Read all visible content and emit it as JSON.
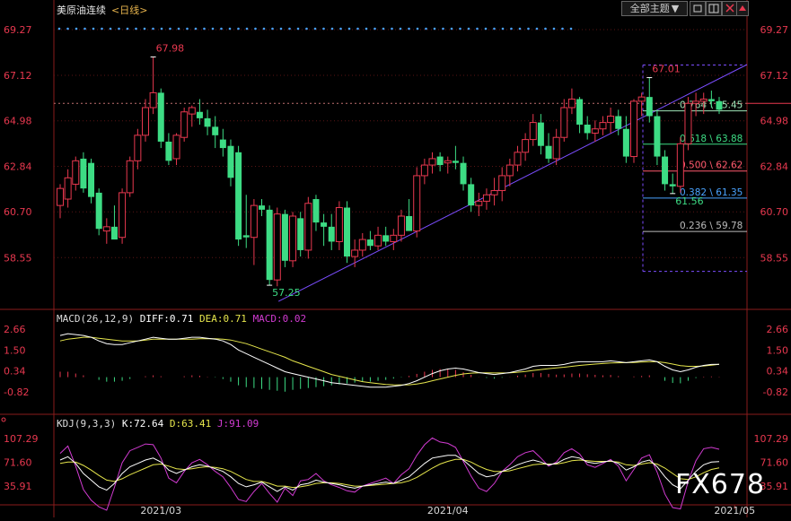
{
  "header": {
    "symbol": "美原油连续",
    "period": "<日线>",
    "theme_button": "全部主题",
    "theme_arrow": "▼"
  },
  "watermark": "FX678",
  "colors": {
    "up": "#e8384f",
    "down": "#3ddc84",
    "macd_diff": "#ffffff",
    "macd_dea": "#e6e64c",
    "macd_bar": "#d23bd2",
    "kdj_j": "#d23bd2",
    "trendline": "#7b4dff",
    "blue_dots": "#4aa3ff"
  },
  "chart_data": {
    "type": "candlestick",
    "title": "",
    "price_axis": {
      "ticks": [
        "69.27",
        "67.12",
        "64.98",
        "62.84",
        "60.70",
        "58.55"
      ],
      "ylim": [
        56.2,
        69.9
      ]
    },
    "x_labels": [
      {
        "label": "2021/03",
        "index": 13
      },
      {
        "label": "2021/04",
        "index": 50
      },
      {
        "label": "2021/05",
        "index": 87
      }
    ],
    "candles": [
      {
        "o": 61.0,
        "h": 62.0,
        "l": 60.4,
        "c": 61.8
      },
      {
        "o": 61.3,
        "h": 62.7,
        "l": 60.9,
        "c": 62.3
      },
      {
        "o": 62.0,
        "h": 63.3,
        "l": 61.7,
        "c": 63.1
      },
      {
        "o": 63.2,
        "h": 63.5,
        "l": 61.6,
        "c": 61.8
      },
      {
        "o": 63.0,
        "h": 63.2,
        "l": 61.1,
        "c": 61.4
      },
      {
        "o": 61.6,
        "h": 61.8,
        "l": 59.6,
        "c": 59.9
      },
      {
        "o": 59.8,
        "h": 60.4,
        "l": 59.2,
        "c": 60.0
      },
      {
        "o": 60.0,
        "h": 61.0,
        "l": 59.5,
        "c": 59.4
      },
      {
        "o": 59.5,
        "h": 61.8,
        "l": 59.2,
        "c": 61.6
      },
      {
        "o": 61.6,
        "h": 63.3,
        "l": 61.4,
        "c": 63.1
      },
      {
        "o": 63.1,
        "h": 64.6,
        "l": 62.7,
        "c": 64.3
      },
      {
        "o": 64.3,
        "h": 66.0,
        "l": 64.0,
        "c": 65.6
      },
      {
        "o": 65.6,
        "h": 67.98,
        "l": 65.3,
        "c": 66.3
      },
      {
        "o": 66.3,
        "h": 66.5,
        "l": 63.7,
        "c": 64.0
      },
      {
        "o": 64.0,
        "h": 64.4,
        "l": 62.9,
        "c": 63.1
      },
      {
        "o": 63.2,
        "h": 64.4,
        "l": 62.9,
        "c": 64.3
      },
      {
        "o": 64.2,
        "h": 65.6,
        "l": 64.0,
        "c": 65.4
      },
      {
        "o": 65.3,
        "h": 65.7,
        "l": 64.7,
        "c": 65.6
      },
      {
        "o": 65.4,
        "h": 66.0,
        "l": 64.8,
        "c": 65.1
      },
      {
        "o": 65.1,
        "h": 65.5,
        "l": 64.3,
        "c": 64.7
      },
      {
        "o": 64.7,
        "h": 65.2,
        "l": 63.7,
        "c": 64.3
      },
      {
        "o": 64.1,
        "h": 64.6,
        "l": 63.3,
        "c": 63.7
      },
      {
        "o": 63.8,
        "h": 64.1,
        "l": 61.9,
        "c": 62.3
      },
      {
        "o": 63.5,
        "h": 63.8,
        "l": 59.1,
        "c": 59.4
      },
      {
        "o": 59.6,
        "h": 61.5,
        "l": 59.0,
        "c": 59.5
      },
      {
        "o": 59.5,
        "h": 61.3,
        "l": 58.2,
        "c": 61.0
      },
      {
        "o": 61.0,
        "h": 61.3,
        "l": 60.5,
        "c": 60.8
      },
      {
        "o": 60.8,
        "h": 61.0,
        "l": 57.25,
        "c": 57.5
      },
      {
        "o": 57.5,
        "h": 60.9,
        "l": 57.2,
        "c": 60.6
      },
      {
        "o": 60.6,
        "h": 60.8,
        "l": 58.1,
        "c": 58.4
      },
      {
        "o": 58.4,
        "h": 60.7,
        "l": 58.1,
        "c": 60.5
      },
      {
        "o": 60.4,
        "h": 60.7,
        "l": 58.6,
        "c": 58.9
      },
      {
        "o": 58.9,
        "h": 61.4,
        "l": 58.5,
        "c": 61.1
      },
      {
        "o": 61.3,
        "h": 61.5,
        "l": 59.8,
        "c": 60.2
      },
      {
        "o": 60.2,
        "h": 60.6,
        "l": 59.1,
        "c": 60.0
      },
      {
        "o": 60.0,
        "h": 60.6,
        "l": 58.9,
        "c": 59.3
      },
      {
        "o": 59.3,
        "h": 61.2,
        "l": 58.9,
        "c": 60.9
      },
      {
        "o": 60.9,
        "h": 61.2,
        "l": 58.3,
        "c": 58.6
      },
      {
        "o": 58.6,
        "h": 59.4,
        "l": 58.1,
        "c": 58.9
      },
      {
        "o": 58.9,
        "h": 59.7,
        "l": 58.6,
        "c": 59.4
      },
      {
        "o": 59.4,
        "h": 59.8,
        "l": 58.9,
        "c": 59.1
      },
      {
        "o": 59.1,
        "h": 60.0,
        "l": 58.9,
        "c": 59.6
      },
      {
        "o": 59.6,
        "h": 60.0,
        "l": 59.1,
        "c": 59.3
      },
      {
        "o": 59.3,
        "h": 59.9,
        "l": 58.9,
        "c": 59.6
      },
      {
        "o": 59.6,
        "h": 60.8,
        "l": 59.3,
        "c": 60.5
      },
      {
        "o": 60.5,
        "h": 61.3,
        "l": 60.1,
        "c": 59.8
      },
      {
        "o": 59.8,
        "h": 62.8,
        "l": 59.5,
        "c": 62.4
      },
      {
        "o": 62.4,
        "h": 63.2,
        "l": 62.0,
        "c": 62.9
      },
      {
        "o": 62.9,
        "h": 63.5,
        "l": 62.5,
        "c": 63.2
      },
      {
        "o": 63.3,
        "h": 63.5,
        "l": 62.6,
        "c": 62.9
      },
      {
        "o": 63.0,
        "h": 63.3,
        "l": 62.5,
        "c": 63.1
      },
      {
        "o": 63.1,
        "h": 63.8,
        "l": 62.7,
        "c": 63.0
      },
      {
        "o": 63.0,
        "h": 63.3,
        "l": 61.7,
        "c": 62.0
      },
      {
        "o": 62.0,
        "h": 62.3,
        "l": 60.7,
        "c": 61.0
      },
      {
        "o": 61.0,
        "h": 61.6,
        "l": 60.5,
        "c": 61.2
      },
      {
        "o": 61.2,
        "h": 61.8,
        "l": 60.8,
        "c": 61.5
      },
      {
        "o": 61.5,
        "h": 62.3,
        "l": 61.0,
        "c": 61.7
      },
      {
        "o": 61.7,
        "h": 62.8,
        "l": 61.2,
        "c": 62.4
      },
      {
        "o": 62.4,
        "h": 63.2,
        "l": 61.9,
        "c": 62.9
      },
      {
        "o": 62.9,
        "h": 63.8,
        "l": 62.6,
        "c": 63.5
      },
      {
        "o": 63.5,
        "h": 64.4,
        "l": 63.1,
        "c": 64.1
      },
      {
        "o": 64.1,
        "h": 65.3,
        "l": 63.8,
        "c": 64.9
      },
      {
        "o": 64.9,
        "h": 65.3,
        "l": 63.4,
        "c": 63.8
      },
      {
        "o": 63.8,
        "h": 64.4,
        "l": 63.0,
        "c": 63.2
      },
      {
        "o": 63.2,
        "h": 64.6,
        "l": 62.9,
        "c": 64.2
      },
      {
        "o": 64.2,
        "h": 66.0,
        "l": 64.0,
        "c": 65.6
      },
      {
        "o": 65.6,
        "h": 66.5,
        "l": 65.3,
        "c": 66.0
      },
      {
        "o": 66.0,
        "h": 66.1,
        "l": 64.4,
        "c": 64.8
      },
      {
        "o": 64.8,
        "h": 65.2,
        "l": 64.1,
        "c": 64.4
      },
      {
        "o": 64.4,
        "h": 65.0,
        "l": 64.0,
        "c": 64.6
      },
      {
        "o": 64.6,
        "h": 65.2,
        "l": 64.3,
        "c": 64.9
      },
      {
        "o": 64.9,
        "h": 65.6,
        "l": 64.4,
        "c": 65.2
      },
      {
        "o": 65.2,
        "h": 65.5,
        "l": 64.3,
        "c": 64.6
      },
      {
        "o": 64.6,
        "h": 65.2,
        "l": 63.0,
        "c": 63.3
      },
      {
        "o": 63.3,
        "h": 66.0,
        "l": 63.0,
        "c": 65.9
      },
      {
        "o": 65.9,
        "h": 66.3,
        "l": 65.2,
        "c": 66.1
      },
      {
        "o": 66.1,
        "h": 67.01,
        "l": 64.9,
        "c": 65.2
      },
      {
        "o": 65.2,
        "h": 65.5,
        "l": 62.9,
        "c": 63.3
      },
      {
        "o": 63.3,
        "h": 63.6,
        "l": 61.7,
        "c": 62.0
      },
      {
        "o": 62.0,
        "h": 62.5,
        "l": 61.56,
        "c": 61.9
      },
      {
        "o": 61.9,
        "h": 64.2,
        "l": 61.6,
        "c": 63.9
      },
      {
        "o": 63.9,
        "h": 66.1,
        "l": 63.6,
        "c": 65.8
      },
      {
        "o": 65.8,
        "h": 66.3,
        "l": 65.2,
        "c": 65.9
      },
      {
        "o": 65.9,
        "h": 66.3,
        "l": 65.3,
        "c": 66.0
      },
      {
        "o": 66.0,
        "h": 66.4,
        "l": 65.6,
        "c": 65.9
      },
      {
        "o": 65.9,
        "h": 66.1,
        "l": 65.3,
        "c": 65.5
      }
    ],
    "markers": {
      "high1": {
        "label": "67.98",
        "index": 12,
        "price": 67.98
      },
      "low1": {
        "label": "57.25",
        "index": 27,
        "price": 57.25
      },
      "high2": {
        "label": "67.01",
        "index": 76,
        "price": 67.01
      },
      "low2": {
        "label": "61.56",
        "index": 79,
        "price": 61.56
      }
    },
    "current_price": 65.8,
    "fib_levels": [
      {
        "label": "0.764 \\ 65.45",
        "price": 65.45,
        "color": "#9fe6b8"
      },
      {
        "label": "0.618 \\ 63.88",
        "price": 63.88,
        "color": "#3ddc84"
      },
      {
        "label": "0.500 \\ 62.62",
        "price": 62.62,
        "color": "#ff5a6e"
      },
      {
        "label": "0.382 \\ 61.35",
        "price": 61.35,
        "color": "#4aa3ff"
      },
      {
        "label": "0.236 \\ 59.78",
        "price": 59.78,
        "color": "#bbbbbb"
      }
    ],
    "macd": {
      "title": "MACD(26,12,9)",
      "diff_label": "DIFF:0.71",
      "dea_label": "DEA:0.71",
      "macd_label": "MACD:0.02",
      "ticks": [
        "2.66",
        "1.50",
        "0.34",
        "-0.82"
      ],
      "ylim": [
        -2.0,
        2.9
      ],
      "diff": [
        2.3,
        2.4,
        2.35,
        2.3,
        2.2,
        2.0,
        1.85,
        1.8,
        1.8,
        1.9,
        2.0,
        2.1,
        2.2,
        2.15,
        2.1,
        2.1,
        2.15,
        2.2,
        2.2,
        2.15,
        2.1,
        2.0,
        1.8,
        1.5,
        1.3,
        1.1,
        0.9,
        0.7,
        0.5,
        0.3,
        0.2,
        0.1,
        0.0,
        -0.1,
        -0.2,
        -0.3,
        -0.35,
        -0.4,
        -0.45,
        -0.5,
        -0.55,
        -0.55,
        -0.55,
        -0.5,
        -0.45,
        -0.35,
        -0.2,
        0.0,
        0.2,
        0.35,
        0.45,
        0.5,
        0.45,
        0.35,
        0.25,
        0.2,
        0.15,
        0.2,
        0.25,
        0.35,
        0.45,
        0.6,
        0.65,
        0.65,
        0.65,
        0.7,
        0.8,
        0.85,
        0.85,
        0.85,
        0.85,
        0.9,
        0.85,
        0.8,
        0.85,
        0.9,
        0.95,
        0.85,
        0.6,
        0.4,
        0.3,
        0.4,
        0.55,
        0.65,
        0.7,
        0.71
      ],
      "dea": [
        2.0,
        2.1,
        2.15,
        2.2,
        2.2,
        2.15,
        2.1,
        2.05,
        2.0,
        2.0,
        2.0,
        2.05,
        2.1,
        2.1,
        2.1,
        2.1,
        2.1,
        2.1,
        2.12,
        2.13,
        2.12,
        2.1,
        2.05,
        1.95,
        1.85,
        1.7,
        1.55,
        1.4,
        1.25,
        1.1,
        0.9,
        0.75,
        0.6,
        0.45,
        0.3,
        0.15,
        0.05,
        -0.05,
        -0.15,
        -0.25,
        -0.3,
        -0.35,
        -0.4,
        -0.42,
        -0.43,
        -0.42,
        -0.38,
        -0.3,
        -0.2,
        -0.1,
        0.0,
        0.1,
        0.18,
        0.22,
        0.24,
        0.24,
        0.23,
        0.23,
        0.24,
        0.27,
        0.31,
        0.37,
        0.42,
        0.47,
        0.51,
        0.55,
        0.6,
        0.65,
        0.69,
        0.72,
        0.75,
        0.78,
        0.79,
        0.8,
        0.81,
        0.83,
        0.85,
        0.85,
        0.8,
        0.72,
        0.64,
        0.6,
        0.6,
        0.62,
        0.66,
        0.71
      ],
      "hist": [
        0.3,
        0.3,
        0.2,
        0.1,
        0.0,
        -0.15,
        -0.25,
        -0.25,
        -0.2,
        -0.1,
        0.0,
        0.05,
        0.1,
        0.05,
        0.0,
        0.0,
        0.05,
        0.1,
        0.08,
        0.02,
        -0.02,
        -0.1,
        -0.25,
        -0.45,
        -0.55,
        -0.6,
        -0.65,
        -0.7,
        -0.75,
        -0.8,
        -0.7,
        -0.65,
        -0.6,
        -0.55,
        -0.5,
        -0.45,
        -0.4,
        -0.35,
        -0.3,
        -0.25,
        -0.25,
        -0.2,
        -0.15,
        -0.08,
        -0.02,
        0.07,
        0.18,
        0.3,
        0.4,
        0.45,
        0.45,
        0.4,
        0.27,
        0.13,
        0.01,
        -0.04,
        -0.08,
        -0.03,
        0.01,
        0.08,
        0.14,
        0.23,
        0.23,
        0.18,
        0.14,
        0.15,
        0.2,
        0.2,
        0.16,
        0.13,
        0.1,
        0.12,
        0.06,
        0.0,
        0.04,
        0.07,
        0.1,
        0.0,
        -0.2,
        -0.32,
        -0.34,
        -0.2,
        -0.05,
        0.03,
        0.04,
        0.02
      ]
    },
    "kdj": {
      "title": "KDJ(9,3,3)",
      "k_label": "K:72.64",
      "d_label": "D:63.41",
      "j_label": "J:91.09",
      "ticks": [
        "107.29",
        "71.60",
        "35.91"
      ],
      "ylim": [
        8,
        122
      ],
      "k": [
        75,
        80,
        70,
        55,
        45,
        35,
        30,
        40,
        55,
        65,
        70,
        75,
        78,
        72,
        60,
        55,
        60,
        65,
        68,
        66,
        62,
        58,
        50,
        40,
        35,
        38,
        42,
        35,
        28,
        35,
        30,
        38,
        40,
        45,
        42,
        40,
        38,
        35,
        33,
        36,
        38,
        40,
        42,
        40,
        45,
        50,
        60,
        70,
        78,
        80,
        82,
        82,
        75,
        65,
        55,
        50,
        52,
        58,
        62,
        68,
        72,
        75,
        72,
        68,
        70,
        76,
        80,
        78,
        72,
        70,
        72,
        74,
        70,
        60,
        65,
        72,
        75,
        65,
        50,
        38,
        32,
        45,
        58,
        68,
        72,
        72.64
      ],
      "d": [
        70,
        72,
        72,
        67,
        60,
        52,
        45,
        43,
        47,
        53,
        58,
        63,
        68,
        69,
        66,
        62,
        61,
        62,
        64,
        65,
        64,
        62,
        58,
        52,
        46,
        43,
        43,
        40,
        36,
        36,
        34,
        35,
        37,
        40,
        41,
        41,
        40,
        38,
        36,
        36,
        37,
        38,
        39,
        40,
        41,
        44,
        49,
        56,
        63,
        69,
        73,
        76,
        76,
        72,
        66,
        61,
        58,
        58,
        59,
        62,
        65,
        68,
        69,
        69,
        69,
        71,
        74,
        75,
        74,
        73,
        73,
        73,
        72,
        68,
        67,
        69,
        71,
        69,
        63,
        55,
        47,
        46,
        50,
        56,
        61,
        63.41
      ],
      "j": [
        85,
        96,
        66,
        31,
        15,
        5,
        0,
        34,
        71,
        89,
        94,
        99,
        98,
        78,
        48,
        41,
        58,
        71,
        76,
        68,
        58,
        50,
        34,
        16,
        13,
        28,
        40,
        25,
        12,
        33,
        22,
        44,
        46,
        55,
        44,
        38,
        34,
        29,
        27,
        36,
        40,
        44,
        48,
        40,
        53,
        62,
        82,
        98,
        108,
        102,
        100,
        94,
        73,
        51,
        33,
        28,
        40,
        58,
        68,
        80,
        86,
        89,
        78,
        66,
        72,
        86,
        92,
        84,
        68,
        64,
        70,
        76,
        66,
        44,
        61,
        78,
        83,
        57,
        24,
        4,
        2,
        43,
        74,
        92,
        94,
        91.09
      ]
    }
  }
}
